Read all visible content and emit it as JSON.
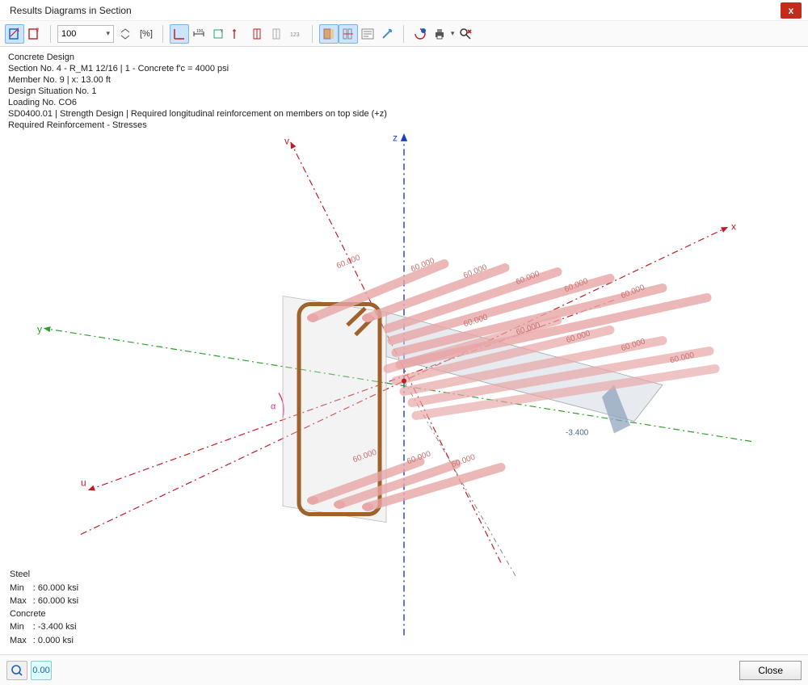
{
  "window": {
    "title": "Results Diagrams in Section",
    "close_label": "x"
  },
  "toolbar": {
    "zoom_value": "100",
    "pct_label": "[%]"
  },
  "info": {
    "l1": "Concrete Design",
    "l2": "Section No. 4 - R_M1 12/16 | 1 - Concrete f'c = 4000 psi",
    "l3": "Member No. 9 | x: 13.00 ft",
    "l4": "Design Situation No. 1",
    "l5": "Loading No. CO6",
    "l6": "SD0400.01 | Strength Design | Required longitudinal reinforcement on members on top side (+z)",
    "l7": "Required Reinforcement - Stresses"
  },
  "axes": {
    "z": "z",
    "y": "y",
    "x": "x",
    "u": "u",
    "v": "v",
    "alpha": "α"
  },
  "diagram": {
    "bar_value": "60.000",
    "concrete_value": "-3.400"
  },
  "results": {
    "steel_hdr": "Steel",
    "steel_min_l": "Min",
    "steel_min_v": ": 60.000 ksi",
    "steel_max_l": "Max",
    "steel_max_v": ": 60.000 ksi",
    "conc_hdr": "Concrete",
    "conc_min_l": "Min",
    "conc_min_v": ":  -3.400 ksi",
    "conc_max_l": "Max",
    "conc_max_v": ":   0.000 ksi"
  },
  "footer": {
    "close_label": "Close",
    "decimals_label": "0.00"
  }
}
